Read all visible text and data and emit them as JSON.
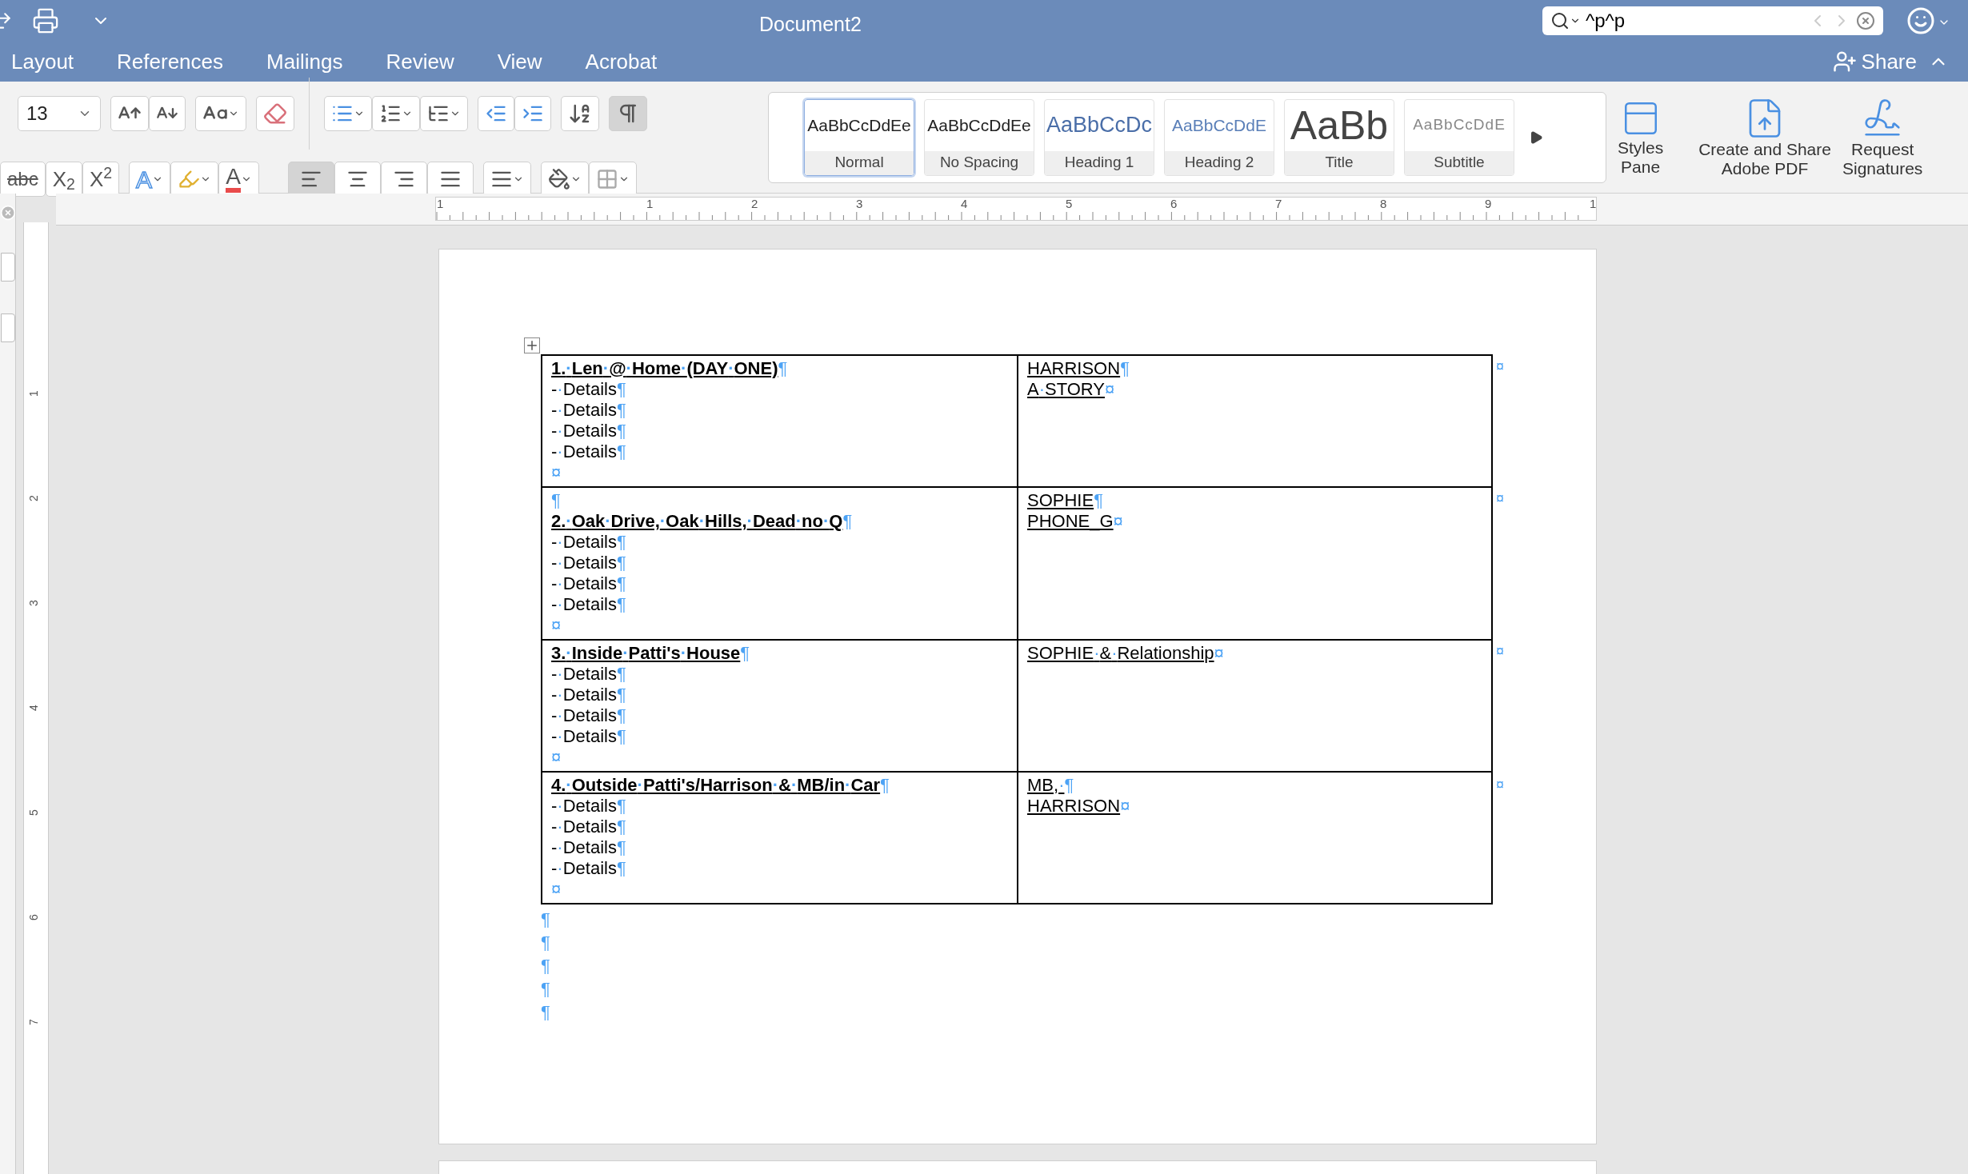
{
  "title_bar": {
    "title": "Document2",
    "search": {
      "value": "^p^p"
    }
  },
  "menu_tabs": [
    {
      "label": "Layout",
      "selected": false
    },
    {
      "label": "References",
      "selected": false
    },
    {
      "label": "Mailings",
      "selected": false
    },
    {
      "label": "Review",
      "selected": false
    },
    {
      "label": "View",
      "selected": false
    },
    {
      "label": "Acrobat",
      "selected": false
    }
  ],
  "share": "Share",
  "toolbar": {
    "font_size": "13",
    "strikethrough": "abc",
    "subscript": "X$_{2}$",
    "superscript": "X$^{2}$",
    "text_effects": "A",
    "font_color": "A",
    "show_formatting": {
      "on": true
    },
    "alignment": [
      {
        "kind": "left",
        "selected": true
      },
      {
        "kind": "center",
        "selected": false
      },
      {
        "kind": "right",
        "selected": false
      },
      {
        "kind": "justify",
        "selected": false
      }
    ]
  },
  "styles": [
    {
      "kind": "normal",
      "sample": "AaBbCcDdEe",
      "name": "Normal",
      "selected": true
    },
    {
      "kind": "normal",
      "sample": "AaBbCcDdEe",
      "name": "No Spacing",
      "selected": false
    },
    {
      "kind": "heading1",
      "sample": "AaBbCcDc",
      "name": "Heading 1",
      "selected": false
    },
    {
      "kind": "heading2",
      "sample": "AaBbCcDdE",
      "name": "Heading 2",
      "selected": false
    },
    {
      "kind": "title",
      "sample": "AaBb",
      "name": "Title",
      "selected": false
    },
    {
      "kind": "subtitle",
      "sample": "AaBbCcDdE",
      "name": "Subtitle",
      "selected": false
    }
  ],
  "ribbon_buttons": [
    {
      "kind": "styles",
      "lines": [
        "Styles",
        "Pane"
      ]
    },
    {
      "kind": "pdf",
      "lines": [
        "Create and Share",
        "Adobe PDF"
      ]
    },
    {
      "kind": "sign",
      "lines": [
        "Request",
        "Signatures"
      ]
    }
  ],
  "ruler": {
    "horizontal": [
      "1",
      "1",
      "2",
      "3",
      "4",
      "5",
      "6",
      "7",
      "8",
      "9",
      "1"
    ],
    "vertical": [
      "1",
      "2",
      "3",
      "4",
      "5",
      "6",
      "7"
    ]
  },
  "table": {
    "rows": [
      {
        "end": "¤",
        "cells": [
          [
            {
              "kind": "heading",
              "text": "1.·Len·@·Home·(DAY·ONE)",
              "mark": "¶"
            },
            {
              "kind": "detail",
              "text": "-·Details",
              "mark": "¶"
            },
            {
              "kind": "detail",
              "text": "-·Details",
              "mark": "¶"
            },
            {
              "kind": "detail",
              "text": "-·Details",
              "mark": "¶"
            },
            {
              "kind": "detail",
              "text": "-·Details",
              "mark": "¶"
            },
            {
              "kind": "empty",
              "mark": "¤"
            }
          ],
          [
            {
              "kind": "label",
              "text": "HARRISON",
              "mark": "¶"
            },
            {
              "kind": "label",
              "text": "A·STORY",
              "mark": "¤"
            }
          ]
        ]
      },
      {
        "end": "¤",
        "cells": [
          [
            {
              "kind": "empty",
              "mark": "¶"
            },
            {
              "kind": "heading",
              "text": "2.·Oak·Drive,·Oak·Hills,·Dead·no·Q",
              "mark": "¶"
            },
            {
              "kind": "detail",
              "text": "-·Details",
              "mark": "¶"
            },
            {
              "kind": "detail",
              "text": "-·Details",
              "mark": "¶"
            },
            {
              "kind": "detail",
              "text": "-·Details",
              "mark": "¶"
            },
            {
              "kind": "detail",
              "text": "-·Details",
              "mark": "¶"
            },
            {
              "kind": "empty",
              "mark": "¤"
            }
          ],
          [
            {
              "kind": "label",
              "text": "SOPHIE",
              "mark": "¶"
            },
            {
              "kind": "label",
              "text": "PHONE_G",
              "mark": "¤"
            }
          ]
        ]
      },
      {
        "end": "¤",
        "cells": [
          [
            {
              "kind": "heading",
              "text": "3.·Inside·Patti's·House",
              "mark": "¶"
            },
            {
              "kind": "detail",
              "text": "-·Details",
              "mark": "¶"
            },
            {
              "kind": "detail",
              "text": "-·Details",
              "mark": "¶"
            },
            {
              "kind": "detail",
              "text": "-·Details",
              "mark": "¶"
            },
            {
              "kind": "detail",
              "text": "-·Details",
              "mark": "¶"
            },
            {
              "kind": "empty",
              "mark": "¤"
            }
          ],
          [
            {
              "kind": "label",
              "text": "SOPHIE·&·Relationship",
              "mark": "¤"
            }
          ]
        ]
      },
      {
        "end": "¤",
        "cells": [
          [
            {
              "kind": "heading",
              "text": "4.·Outside·Patti's/Harrison·&·MB/in·Car",
              "mark": "¶"
            },
            {
              "kind": "detail",
              "text": "-·Details",
              "mark": "¶"
            },
            {
              "kind": "detail",
              "text": "-·Details",
              "mark": "¶"
            },
            {
              "kind": "detail",
              "text": "-·Details",
              "mark": "¶"
            },
            {
              "kind": "detail",
              "text": "-·Details",
              "mark": "¶"
            },
            {
              "kind": "empty",
              "mark": "¤"
            }
          ],
          [
            {
              "kind": "label",
              "text": "MB,·",
              "mark": "¶"
            },
            {
              "kind": "label",
              "text": "HARRISON",
              "mark": "¤"
            }
          ]
        ]
      }
    ]
  },
  "trailing_marks": [
    "¶",
    "¶",
    "¶",
    "¶",
    "¶"
  ]
}
